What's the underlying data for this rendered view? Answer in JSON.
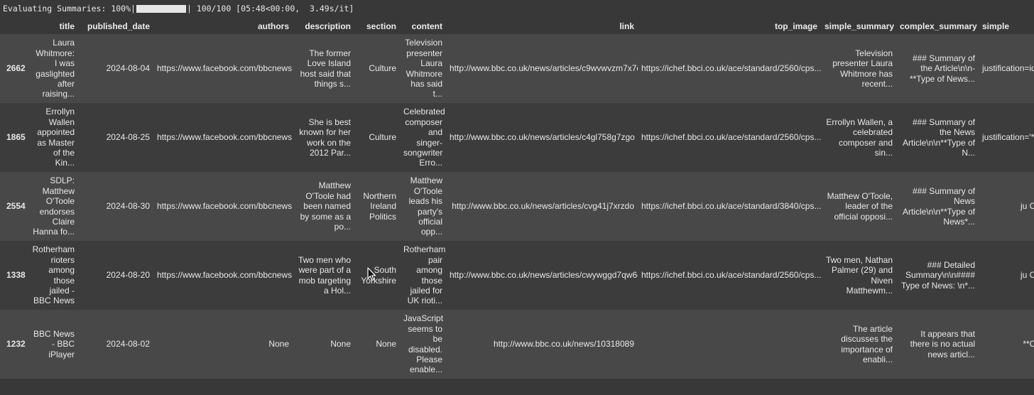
{
  "progress": {
    "label": "Evaluating Summaries: 100%|",
    "stats": "| 100/100 [05:48<00:00,  3.49s/it]",
    "fraction": 1.0
  },
  "table": {
    "columns": [
      "",
      "title",
      "published_date",
      "authors",
      "description",
      "section",
      "content",
      "link",
      "top_image",
      "simple_summary",
      "complex_summary",
      "simple"
    ],
    "rows": [
      {
        "index": "2662",
        "title": "Laura Whitmore: I was gaslighted after raising...",
        "published_date": "2024-08-04",
        "authors": "https://www.facebook.com/bbcnews",
        "description": "The former Love Island host said that things s...",
        "section": "Culture",
        "content": "Television presenter Laura Whitmore has said t...",
        "link": "http://www.bbc.co.uk/news/articles/c9wvwvzm7x7o",
        "top_image": "https://ichef.bbci.co.uk/ace/standard/2560/cps...",
        "simple_summary": "Television presenter Laura Whitmore has recent...",
        "complex_summary": "### Summary of the Article\\n\\n- **Type of News...",
        "simple_eval": "justification=identi"
      },
      {
        "index": "1865",
        "title": "Errollyn Wallen appointed as Master of the Kin...",
        "published_date": "2024-08-25",
        "authors": "https://www.facebook.com/bbcnews",
        "description": "She is best known for her work on the 2012 Par...",
        "section": "Culture",
        "content": "Celebrated composer and singer-songwriter Erro...",
        "link": "http://www.bbc.co.uk/news/articles/c4gl758g7zgo",
        "top_image": "https://ichef.bbci.co.uk/ace/standard/2560/cps...",
        "simple_summary": "Errollyn Wallen, a celebrated composer and sin...",
        "complex_summary": "### Summary of the News Article\\n\\n**Type of N...",
        "simple_eval": "justification='** ar"
      },
      {
        "index": "2554",
        "title": "SDLP: Matthew O'Toole endorses Claire Hanna fo...",
        "published_date": "2024-08-30",
        "authors": "https://www.facebook.com/bbcnews",
        "description": "Matthew O'Toole had been named by some as a po...",
        "section": "Northern Ireland Politics",
        "content": "Matthew O'Toole leads his party's official opp...",
        "link": "http://www.bbc.co.uk/news/articles/cvg41j7xrzdo",
        "top_image": "https://ichef.bbci.co.uk/ace/standard/3840/cps...",
        "simple_summary": "Matthew O'Toole, leader of the official opposi...",
        "complex_summary": "### Summary of News Article\\n\\n**Type of News*...",
        "simple_eval": "ju Cate"
      },
      {
        "index": "1338",
        "title": "Rotherham rioters among those jailed - BBC News",
        "published_date": "2024-08-20",
        "authors": "https://www.facebook.com/bbcnews",
        "description": "Two men who were part of a mob targeting a Hol...",
        "section": "South Yorkshire",
        "content": "Rotherham pair among those jailed for UK rioti...",
        "link": "http://www.bbc.co.uk/news/articles/cwywggd7qw6o",
        "top_image": "https://ichef.bbci.co.uk/ace/standard/2560/cps...",
        "simple_summary": "Two men, Nathan Palmer (29) and Niven Matthewm...",
        "complex_summary": "### Detailed Summary\\n\\n#### Type of News: \\n*...",
        "simple_eval": "ju Cate"
      },
      {
        "index": "1232",
        "title": "BBC News - BBC iPlayer",
        "published_date": "2024-08-02",
        "authors": "None",
        "description": "None",
        "section": "None",
        "content": "JavaScript seems to be disabled. Please enable...",
        "link": "http://www.bbc.co.uk/news/10318089",
        "top_image": "",
        "simple_summary": "The article discusses the importance of enabli...",
        "complex_summary": "It appears that there is no actual news articl...",
        "simple_eval": "**Cate"
      }
    ]
  },
  "colors": {
    "background": "#383838",
    "row_odd": "#484848",
    "row_even": "#3c3c3c",
    "text": "#e8e8e8"
  },
  "icons": {
    "cursor": "mouse-pointer-icon"
  }
}
